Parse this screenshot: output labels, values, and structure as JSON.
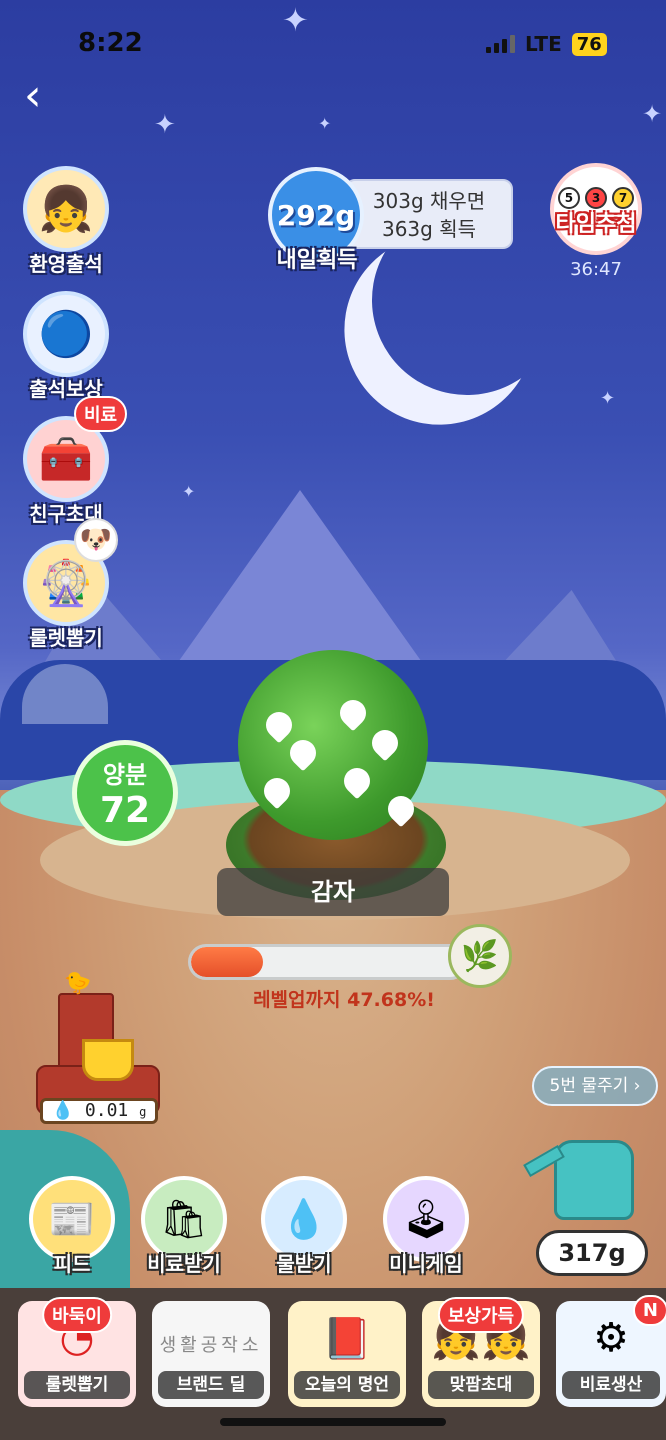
{
  "status_bar": {
    "time": "8:22",
    "network": "LTE",
    "battery": "76"
  },
  "nav": {
    "back_icon": "chevron-left-icon"
  },
  "side_menu": [
    {
      "label": "환영출석",
      "icon": "girl-avatar-icon"
    },
    {
      "label": "출석보상",
      "icon": "potion-bottle-icon"
    },
    {
      "label": "친구초대",
      "icon": "treasure-chest-icon",
      "badge": "비료"
    },
    {
      "label": "룰렛뽑기",
      "icon": "roulette-icon",
      "badge_icon": "puppy-icon"
    }
  ],
  "harvest": {
    "amount": "292g",
    "label": "내일획득",
    "info_line1": "303g 채우면",
    "info_line2": "363g 획득"
  },
  "time_lottery": {
    "label": "타임추첨",
    "balls": [
      "5",
      "3",
      "7"
    ],
    "timer": "36:47"
  },
  "nutrient": {
    "title": "양분",
    "value": "72"
  },
  "crop": {
    "name": "감자"
  },
  "progress": {
    "percent": 47.68,
    "text": "레벨업까지 47.68%!"
  },
  "water_tank": {
    "amount": "0.01",
    "unit": "g"
  },
  "water_button": {
    "label": "5번 물주기 ›"
  },
  "watering_can": {
    "amount": "317g"
  },
  "actions": [
    {
      "label": "피드",
      "icon": "feed-icon",
      "color": "#ffe07a"
    },
    {
      "label": "비료받기",
      "icon": "fertilizer-bag-icon",
      "color": "#c8ecc0"
    },
    {
      "label": "물받기",
      "icon": "water-drop-icon",
      "color": "#d7ecff"
    },
    {
      "label": "미니게임",
      "icon": "game-console-icon",
      "color": "#e6d7ff"
    }
  ],
  "tray_cards": [
    {
      "label": "룰렛뽑기",
      "tag": "바둑이"
    },
    {
      "label": "브랜드 딜",
      "tag": "",
      "art_text": "생활공작소"
    },
    {
      "label": "오늘의 명언",
      "tag": ""
    },
    {
      "label": "맞팜초대",
      "tag": "보상가득"
    },
    {
      "label": "비료생산",
      "tag": "N"
    }
  ]
}
